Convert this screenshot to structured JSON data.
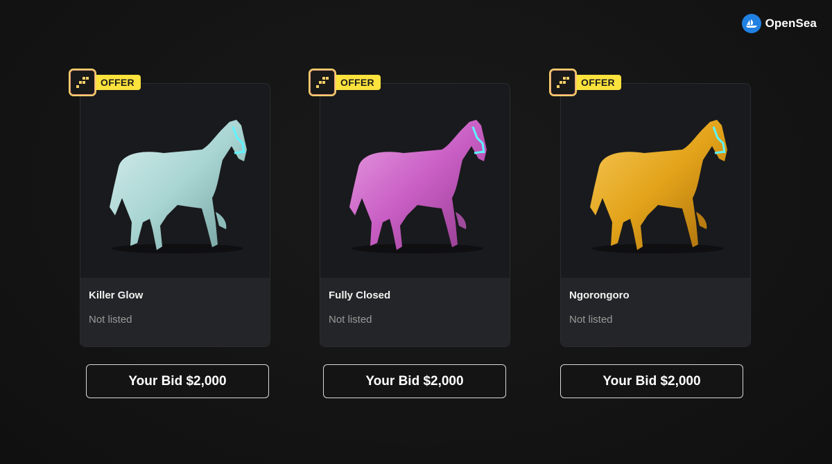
{
  "brand": {
    "name": "OpenSea",
    "icon": "opensea-logo-icon",
    "color": "#2081e2"
  },
  "badge_label": "OFFER",
  "badge_icon": "offer-squares-icon",
  "cards": [
    {
      "title": "Killer Glow",
      "status": "Not listed",
      "button": "Your Bid $2,000",
      "image": "horse-image-silver",
      "horse_color": "#a9d5d3"
    },
    {
      "title": "Fully Closed",
      "status": "Not listed",
      "button": "Your Bid $2,000",
      "image": "horse-image-pink",
      "horse_color": "#c95ec4"
    },
    {
      "title": "Ngorongoro",
      "status": "Not listed",
      "button": "Your Bid $2,000",
      "image": "horse-image-gold",
      "horse_color": "#e3a31a"
    }
  ]
}
